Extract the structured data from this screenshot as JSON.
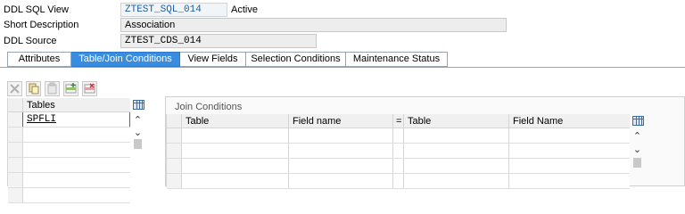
{
  "header": {
    "ddl_sql_view": {
      "label": "DDL SQL View",
      "value": "ZTEST_SQL_014",
      "status": "Active"
    },
    "short_description": {
      "label": "Short Description",
      "value": "Association"
    },
    "ddl_source": {
      "label": "DDL Source",
      "value": "ZTEST_CDS_014"
    }
  },
  "tabs": [
    {
      "label": "Attributes"
    },
    {
      "label": "Table/Join Conditions"
    },
    {
      "label": "View Fields"
    },
    {
      "label": "Selection Conditions"
    },
    {
      "label": "Maintenance Status"
    }
  ],
  "toolbar": {
    "icons": [
      "delete-icon",
      "copy-icon",
      "paste-icon",
      "insert-row-icon",
      "delete-row-icon"
    ]
  },
  "tables_grid": {
    "header": "Tables",
    "rows": [
      "SPFLI",
      "",
      "",
      "",
      "",
      ""
    ]
  },
  "join_conditions": {
    "title": "Join Conditions",
    "columns": [
      "Table",
      "Field name",
      "=",
      "Table",
      "Field Name"
    ]
  },
  "colors": {
    "active_tab": "#3a8dde",
    "value_text": "#1a5fa8"
  }
}
